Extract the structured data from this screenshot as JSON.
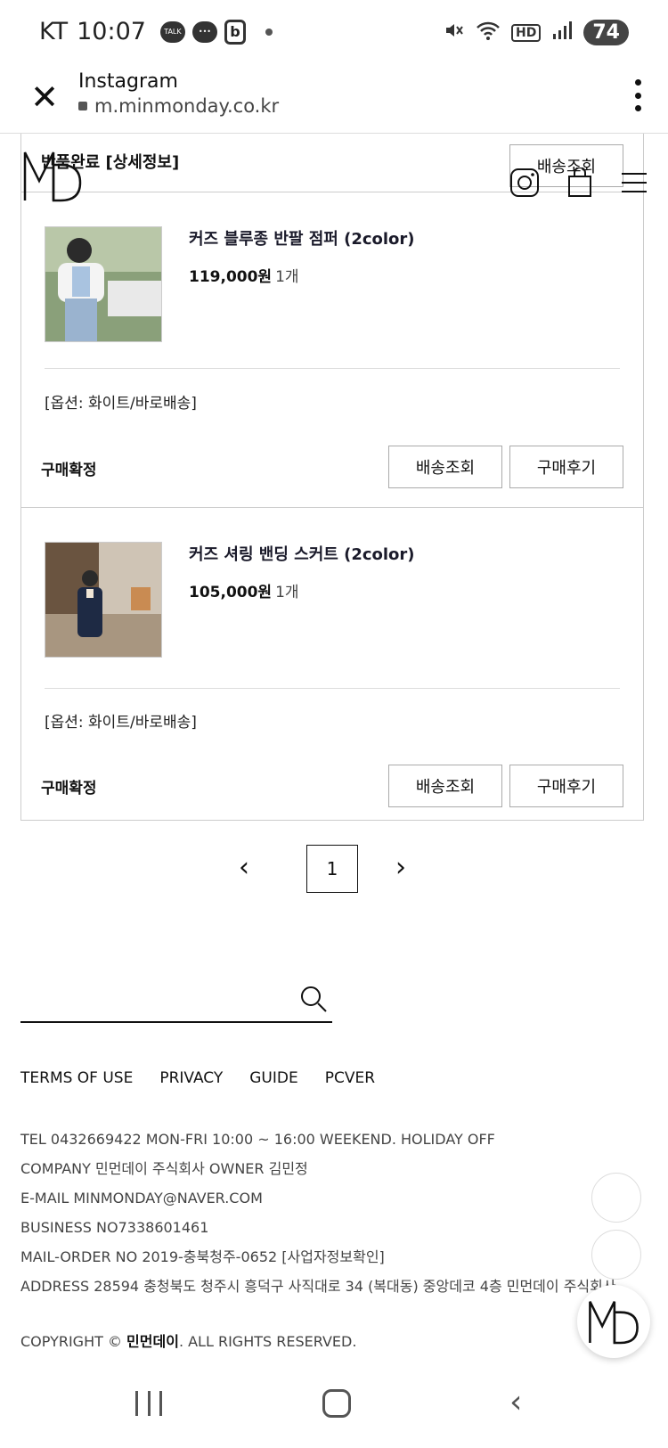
{
  "status_bar": {
    "carrier": "KT",
    "time": "10:07",
    "talk_label": "TALK",
    "battery": "74",
    "hd_label": "HD"
  },
  "browser": {
    "title": "Instagram",
    "url": "m.minmonday.co.kr"
  },
  "order_header": {
    "status": "반품완료 [상세정보]",
    "track_button": "배송조회"
  },
  "items": [
    {
      "name": "커즈 블루종 반팔 점퍼 (2color)",
      "price": "119,000원",
      "qty": "1개",
      "option": "[옵션: 화이트/바로배송]",
      "status": "구매확정",
      "track_button": "배송조회",
      "review_button": "구매후기"
    },
    {
      "name": "커즈 셔링 밴딩 스커트 (2color)",
      "price": "105,000원",
      "qty": "1개",
      "option": "[옵션: 화이트/바로배송]",
      "status": "구매확정",
      "track_button": "배송조회",
      "review_button": "구매후기"
    }
  ],
  "pagination": {
    "prev": "‹",
    "current": "1",
    "next": "›"
  },
  "search": {
    "placeholder": ""
  },
  "footer": {
    "links": [
      "TERMS OF USE",
      "PRIVACY",
      "GUIDE",
      "PCVER"
    ],
    "tel": "TEL 0432669422 MON-FRI 10:00 ~ 16:00 WEEKEND. HOLIDAY OFF",
    "company": "COMPANY 민먼데이 주식회사 OWNER 김민정",
    "email": "E-MAIL MINMONDAY@NAVER.COM",
    "business": "BUSINESS NO7338601461",
    "mail_order": "MAIL-ORDER NO 2019-충북청주-0652 [사업자정보확인]",
    "address": "ADDRESS 28594 충청북도 청주시 흥덕구 사직대로 34 (복대동) 중앙데코 4층 민먼데이 주식회사",
    "copyright_prefix": "COPYRIGHT © ",
    "copyright_brand": "민먼데이",
    "copyright_suffix": ". ALL RIGHTS RESERVED."
  },
  "colors": {
    "text": "#111111",
    "border": "#cccccc",
    "background": "#ffffff"
  }
}
